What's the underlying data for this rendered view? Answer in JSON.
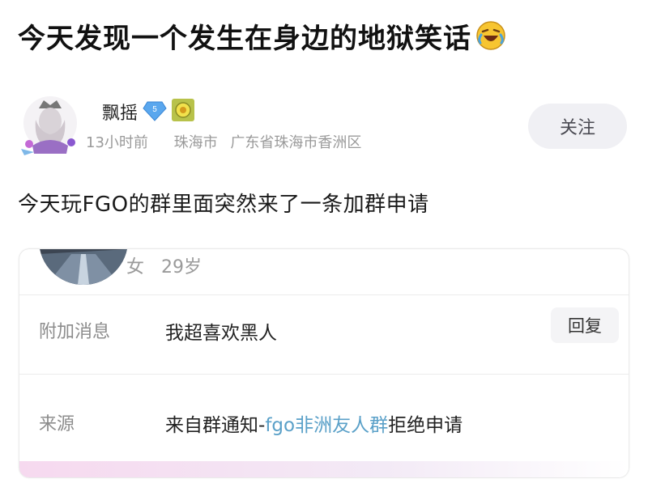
{
  "post": {
    "title": "今天发现一个发生在身边的地狱笑话",
    "title_emoji": "rolling-on-floor-laughing-emoji",
    "author": {
      "name": "飘摇",
      "level": "5",
      "time": "13小时前",
      "city": "珠海市",
      "location": "广东省珠海市香洲区"
    },
    "follow_label": "关注",
    "body": "今天玩FGO的群里面突然来了一条加群申请"
  },
  "request_card": {
    "gender": "女",
    "age": "29岁",
    "message_label": "附加消息",
    "message_value": "我超喜欢黑人",
    "reply_label": "回复",
    "source_label": "来源",
    "source_prefix": "来自群通知-",
    "source_group": "fgo非洲友人群",
    "source_suffix": "拒绝申请"
  },
  "colors": {
    "link": "#5aa0c8",
    "follow_bg": "#f0f0f4",
    "meta_gray": "#9a9a9a"
  }
}
